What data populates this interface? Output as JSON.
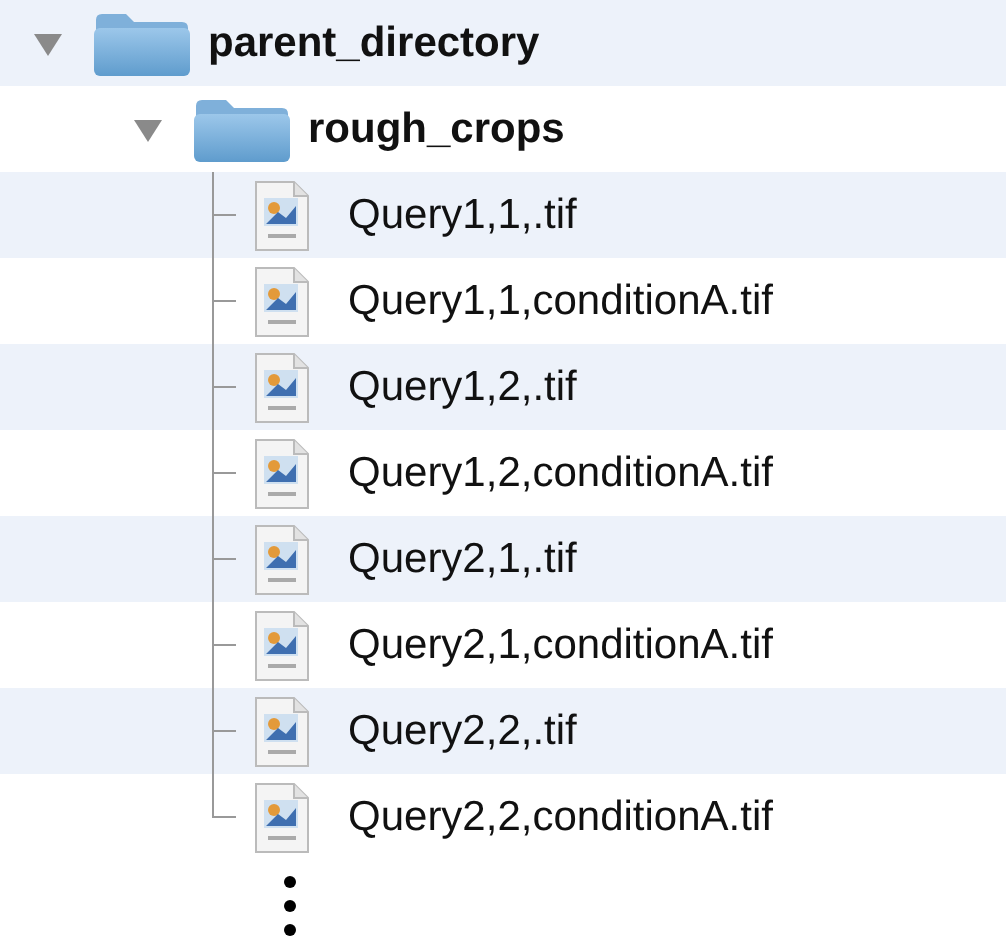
{
  "tree": [
    {
      "name": "parent_directory",
      "kind": "folder",
      "expanded": true,
      "children": [
        {
          "name": "rough_crops",
          "kind": "folder",
          "expanded": true,
          "children": [
            {
              "name": "Query1,1,.tif",
              "kind": "file"
            },
            {
              "name": "Query1,1,conditionA.tif",
              "kind": "file"
            },
            {
              "name": "Query1,2,.tif",
              "kind": "file"
            },
            {
              "name": "Query1,2,conditionA.tif",
              "kind": "file"
            },
            {
              "name": "Query2,1,.tif",
              "kind": "file"
            },
            {
              "name": "Query2,1,conditionA.tif",
              "kind": "file"
            },
            {
              "name": "Query2,2,.tif",
              "kind": "file"
            },
            {
              "name": "Query2,2,conditionA.tif",
              "kind": "file"
            }
          ]
        }
      ]
    }
  ]
}
